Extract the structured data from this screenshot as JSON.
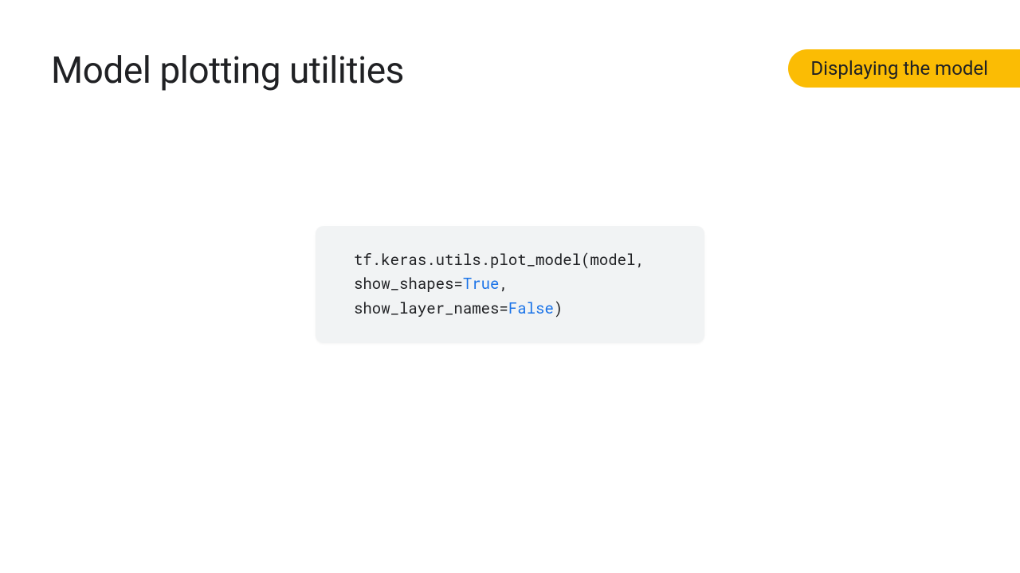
{
  "slide": {
    "title": "Model plotting utilities",
    "badge": "Displaying the model"
  },
  "code": {
    "line1_pre": "tf.keras.utils.plot_model(model,",
    "line2_pre": "show_shapes=",
    "line2_kw": "True",
    "line2_post": ",",
    "line3_pre": "show_layer_names=",
    "line3_kw": "False",
    "line3_post": ")"
  }
}
